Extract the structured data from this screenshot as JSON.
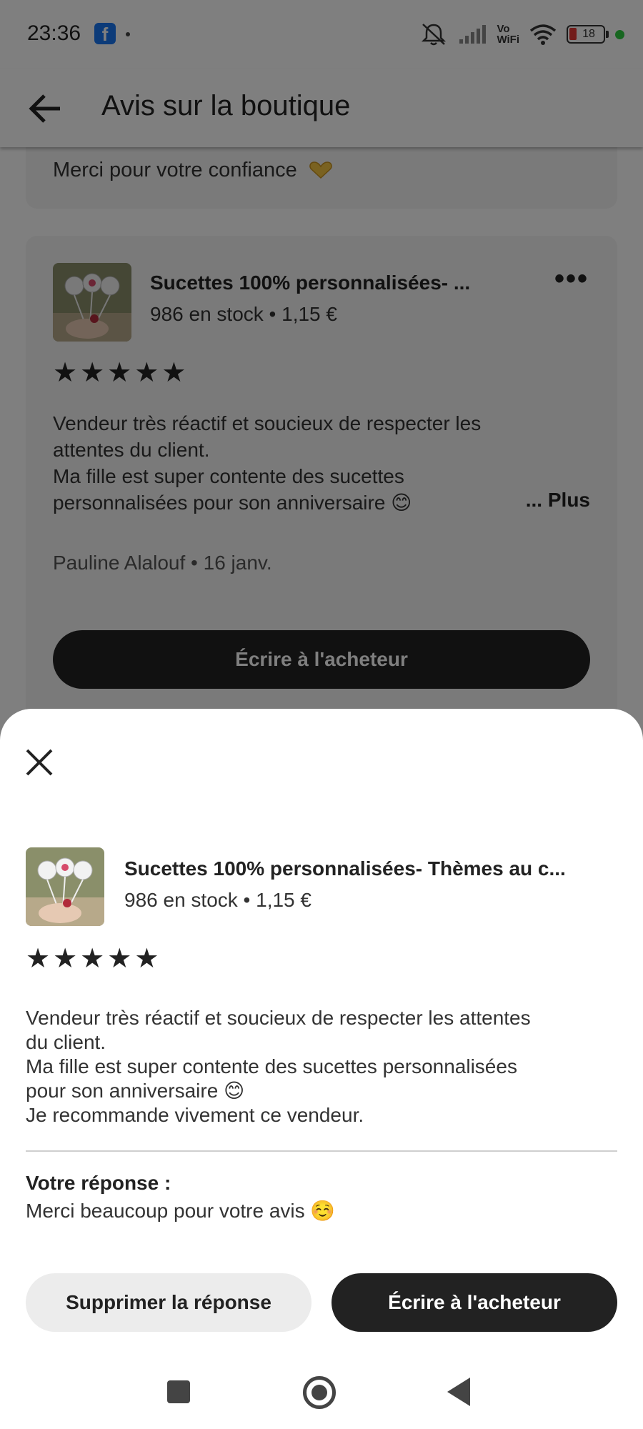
{
  "status_bar": {
    "time": "23:36",
    "fb_icon_letter": "f",
    "vo": "Vo",
    "wifi": "WiFi",
    "battery": "18"
  },
  "header": {
    "title": "Avis sur la boutique"
  },
  "previous_card": {
    "text": "Merci pour votre confiance"
  },
  "review_card": {
    "product_title": "Sucettes  100% personnalisées- ...",
    "product_meta": "986 en stock • 1,15 €",
    "stars": [
      "★",
      "★",
      "★",
      "★",
      "★"
    ],
    "review_line1": "Vendeur très réactif et soucieux de respecter les",
    "review_line2": "attentes du client.",
    "review_line3": "Ma fille est super contente des sucettes",
    "review_line4": "personnalisées pour son anniversaire 😊",
    "more_label": "... Plus",
    "author": "Pauline Alalouf • 16 janv.",
    "button_label": "Écrire à l'acheteur"
  },
  "sheet": {
    "product_title": "Sucettes  100% personnalisées- Thèmes au c...",
    "product_meta": "986 en stock • 1,15 €",
    "stars": [
      "★",
      "★",
      "★",
      "★",
      "★"
    ],
    "review_line1": "Vendeur très réactif et soucieux de respecter les attentes",
    "review_line2": "du client.",
    "review_line3": "Ma fille est super contente des sucettes personnalisées",
    "review_line4": "pour son anniversaire 😊",
    "review_line5": "Je recommande vivement ce vendeur.",
    "reply_label": "Votre réponse :",
    "reply_text": "Merci beaucoup pour votre avis ☺️",
    "delete_button": "Supprimer la réponse",
    "write_button": "Écrire à l'acheteur"
  },
  "colors": {
    "accent_dark": "#222222",
    "heart": "#f5c542",
    "battery_low": "#e53935",
    "camera_dot": "#2ecc40"
  }
}
